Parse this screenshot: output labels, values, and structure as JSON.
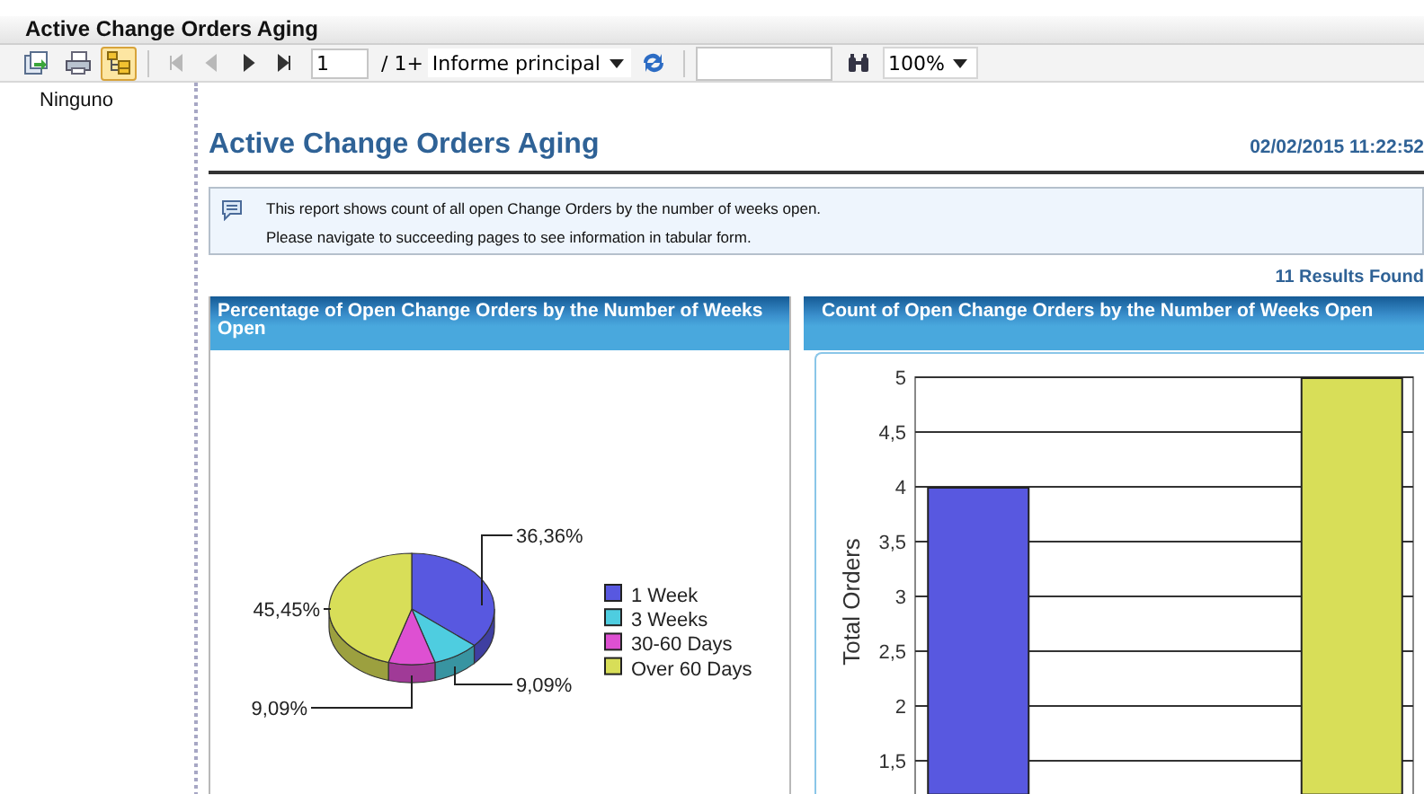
{
  "window": {
    "title": "Active Change Orders Aging"
  },
  "toolbar": {
    "buttons": [
      {
        "kind": "export",
        "selected": false
      },
      {
        "kind": "print",
        "selected": false
      },
      {
        "kind": "tree",
        "selected": true
      }
    ],
    "nav": [
      {
        "kind": "first",
        "disabled": true
      },
      {
        "kind": "prev",
        "disabled": true
      },
      {
        "kind": "next",
        "disabled": false
      },
      {
        "kind": "last",
        "disabled": false
      }
    ],
    "page": "1",
    "page_count": "/ 1+",
    "report_select": "Informe principal",
    "zoom": "100%"
  },
  "sidebar": {
    "items": [
      {
        "label": "Ninguno"
      }
    ]
  },
  "report": {
    "title": "Active Change Orders Aging",
    "timestamp": "02/02/2015 11:22:52",
    "info": [
      "This report shows count of all open Change Orders by the number of weeks open.",
      "Please navigate to succeeding pages to see information in tabular form."
    ],
    "results": "11 Results Found"
  },
  "charts": [
    {
      "title": "Percentage of Open Change Orders by the Number of Weeks Open",
      "chart_data": {
        "type": "pie",
        "categories": [
          "1 Week",
          "3 Weeks",
          "30-60 Days",
          "Over 60 Days"
        ],
        "values": [
          36.36,
          9.09,
          9.09,
          45.45
        ],
        "colors": [
          "#5858e0",
          "#4ecde0",
          "#de50d2",
          "#d8de58"
        ],
        "value_labels": [
          "36,36%",
          "9,09%",
          "9,09%",
          "45,45%"
        ],
        "legend": "right"
      }
    },
    {
      "title": "Count of Open Change Orders by the Number of Weeks Open",
      "chart_data": {
        "type": "bar",
        "ylabel": "Total Orders",
        "values": [
          4,
          null,
          null,
          5
        ],
        "colors": [
          "#5858e0",
          null,
          null,
          "#d8de58"
        ],
        "ylim": [
          1.2,
          5
        ],
        "grid": true,
        "yticks": [
          {
            "value": 1.5,
            "label": "1,5"
          },
          {
            "value": 2,
            "label": "2"
          },
          {
            "value": 2.5,
            "label": "2,5"
          },
          {
            "value": 3,
            "label": "3"
          },
          {
            "value": 3.5,
            "label": "3,5"
          },
          {
            "value": 4,
            "label": "4"
          },
          {
            "value": 4.5,
            "label": "4,5"
          },
          {
            "value": 5,
            "label": "5"
          }
        ]
      }
    }
  ]
}
